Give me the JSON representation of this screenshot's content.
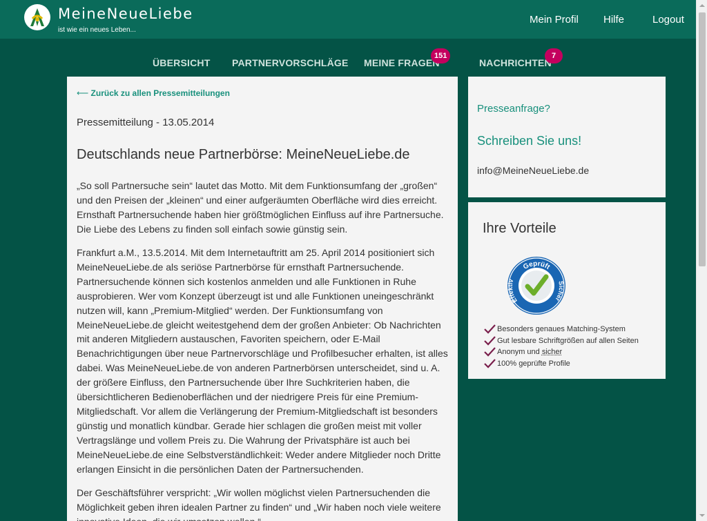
{
  "brand": {
    "title": "MeineNeueLiebe",
    "tagline": "ist wie ein neues Leben..."
  },
  "top_nav": {
    "profile": "Mein Profil",
    "help": "Hilfe",
    "logout": "Logout"
  },
  "main_nav": {
    "overview": "ÜBERSICHT",
    "suggestions": "PARTNERVORSCHLÄGE",
    "questions": "MEINE FRAGEN",
    "questions_badge": "151",
    "messages": "NACHRICHTEN",
    "messages_badge": "7"
  },
  "article": {
    "back_link": "Zurück zu allen Pressemitteilungen",
    "date": "Pressemitteilung - 13.05.2014",
    "headline": "Deutschlands neue Partnerbörse: MeineNeueLiebe.de",
    "p1": "„So soll Partnersuche sein“ lautet das Motto. Mit dem Funktionsumfang der „großen“ und den Preisen der „kleinen“ und einer aufgeräumten Oberfläche wird dies erreicht. Ernsthaft Partnersuchende haben hier größtmöglichen Einfluss auf ihre Partnersuche. Die Liebe des Lebens zu finden soll einfach sowie günstig sein.",
    "p2": "Frankfurt a.M., 13.5.2014. Mit dem Internetauftritt am 25. April 2014 positioniert sich MeineNeueLiebe.de als seriöse Partnerbörse für ernsthaft Partnersuchende. Partnersuchende können sich kostenlos anmelden und alle Funktionen in Ruhe ausprobieren. Wer vom Konzept überzeugt ist und alle Funktionen uneingeschränkt nutzen will, kann „Premium-Mitglied“ werden. Der Funktionsumfang von MeineNeueLiebe.de gleicht weitestgehend dem der großen Anbieter: Ob Nachrichten mit anderen Mitgliedern austauschen, Favoriten speichern, oder E-Mail Benachrichtigungen über neue Partnervorschläge und Profilbesucher erhalten, ist alles dabei. Was MeineNeueLiebe.de von anderen Partnerbörsen unterscheidet, sind u. A. der größere Einfluss, den Partnersuchende über Ihre Suchkriterien haben, die übersichtlicheren Bedienoberflächen und der niedrigere Preis für eine Premium-Mitgliedschaft. Vor allem die Verlängerung der Premium-Mitgliedschaft ist besonders günstig und monatlich kündbar. Gerade hier schlagen die großen meist mit voller Vertragslänge und vollem Preis zu. Die Wahrung der Privatsphäre ist auch bei MeineNeueLiebe.de eine Selbstverständlichkeit: Weder andere Mitglieder noch Dritte erlangen Einsicht in die persönlichen Daten der Partnersuchenden.",
    "p3": "Der Geschäftsführer verspricht: „Wir wollen möglichst vielen Partnersuchenden die Möglichkeit geben ihren idealen Partner zu finden“ und „Wir haben noch viele weitere innovative Ideen, die wir umsetzen wollen.“"
  },
  "press_card": {
    "inquiry": "Presseanfrage?",
    "write_us": "Schreiben Sie uns!",
    "email": "info@MeineNeueLiebe.de"
  },
  "benefits_card": {
    "title": "Ihre Vorteile",
    "seal_top": "Geprüft",
    "seal_left": "Effektiv",
    "seal_right": "Sicher",
    "features": [
      "Besonders genaues Matching-System",
      "Gut lesbare Schriftgrößen auf allen Seiten",
      "Anonym und",
      "100% geprüfte Profile"
    ],
    "feature_3_emph": "sicher"
  },
  "colors": {
    "header": "#0a6b5a",
    "background": "#045346",
    "accent": "#18907c",
    "badge": "#c4005e",
    "check": "#7a1f4c"
  }
}
